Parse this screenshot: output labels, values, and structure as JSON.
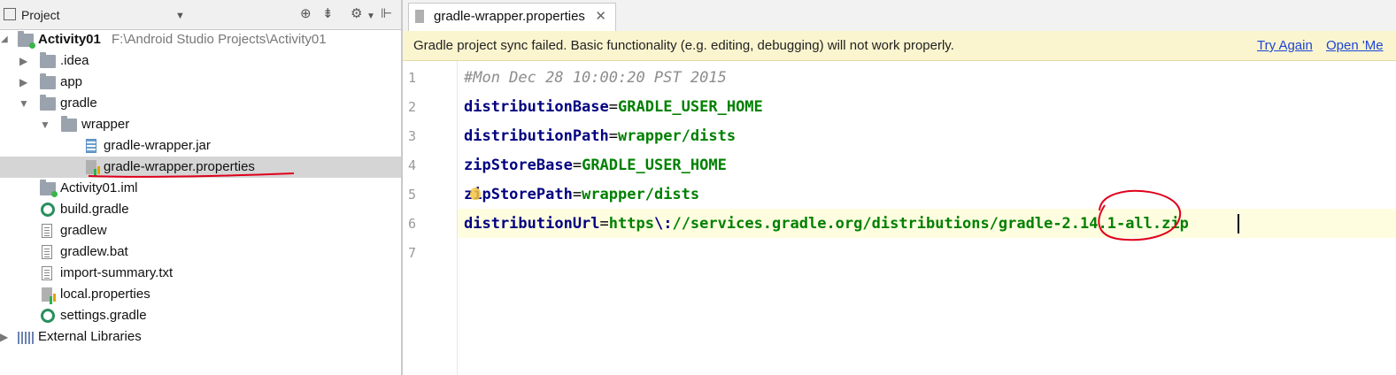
{
  "project_panel": {
    "title": "Project",
    "tree": [
      {
        "label": "Activity01",
        "path": "F:\\Android Studio Projects\\Activity01",
        "icon": "module-folder-icon",
        "expanded": true
      },
      {
        "label": ".idea",
        "icon": "folder-icon",
        "expanded": false
      },
      {
        "label": "app",
        "icon": "folder-icon",
        "expanded": false
      },
      {
        "label": "gradle",
        "icon": "folder-icon",
        "expanded": true
      },
      {
        "label": "wrapper",
        "icon": "folder-icon",
        "expanded": true
      },
      {
        "label": "gradle-wrapper.jar",
        "icon": "jar-file-icon"
      },
      {
        "label": "gradle-wrapper.properties",
        "icon": "properties-file-icon",
        "selected": true
      },
      {
        "label": "Activity01.iml",
        "icon": "iml-file-icon"
      },
      {
        "label": "build.gradle",
        "icon": "gradle-file-icon"
      },
      {
        "label": "gradlew",
        "icon": "text-file-icon"
      },
      {
        "label": "gradlew.bat",
        "icon": "text-file-icon"
      },
      {
        "label": "import-summary.txt",
        "icon": "text-file-icon"
      },
      {
        "label": "local.properties",
        "icon": "properties-file-icon"
      },
      {
        "label": "settings.gradle",
        "icon": "gradle-file-icon"
      },
      {
        "label": "External Libraries",
        "icon": "libraries-icon",
        "expanded": false
      }
    ]
  },
  "editor": {
    "tab_label": "gradle-wrapper.properties",
    "tab_close": "✕",
    "banner": {
      "message": "Gradle project sync failed. Basic functionality (e.g. editing, debugging) will not work properly.",
      "try_again": "Try Again",
      "open": "Open 'Me"
    },
    "lines": [
      {
        "number": "1",
        "comment": "#Mon Dec 28 10:00:20 PST 2015"
      },
      {
        "number": "2",
        "key": "distributionBase",
        "eq": "=",
        "value": "GRADLE_USER_HOME"
      },
      {
        "number": "3",
        "key": "distributionPath",
        "eq": "=",
        "value": "wrapper/dists"
      },
      {
        "number": "4",
        "key": "zipStoreBase",
        "eq": "=",
        "value": "GRADLE_USER_HOME"
      },
      {
        "number": "5",
        "key": "zipStorePath",
        "eq": "=",
        "value": "wrapper/dists"
      },
      {
        "number": "6",
        "key": "distributionUrl",
        "eq": "=",
        "value_a": "https",
        "escape": "\\:",
        "value_b": "//services.gradle.org/distributions/gradle-2.14.1-all.zip"
      },
      {
        "number": "7"
      }
    ]
  },
  "colors": {
    "comment": "#8c8c8c",
    "key": "#000080",
    "value": "#008000",
    "annotation": "#e0001b",
    "banner_bg": "#fbf5cf",
    "link": "#1e44d8"
  }
}
